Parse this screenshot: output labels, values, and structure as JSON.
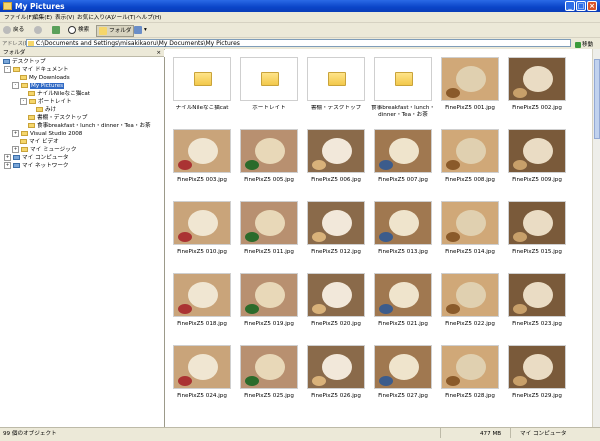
{
  "window": {
    "title": "My Pictures"
  },
  "menu": [
    "ファイル(F)",
    "編集(E)",
    "表示(V)",
    "お気に入り(A)",
    "ツール(T)",
    "ヘルプ(H)"
  ],
  "toolbar": {
    "back": "戻る",
    "search": "検索",
    "folders": "フォルダ"
  },
  "address": {
    "label": "アドレス(D)",
    "path": "C:\\Documents and Settings\\misakikaoru\\My Documents\\My Pictures",
    "go": "移動"
  },
  "pane": {
    "title": "フォルダ",
    "close": "×"
  },
  "tree": [
    {
      "label": "デスクトップ"
    },
    {
      "label": "マイ ドキュメント"
    },
    {
      "label": "My Downloads"
    },
    {
      "label": "My Pictures"
    },
    {
      "label": "ナイルNileなこ猫cat"
    },
    {
      "label": "ポートレイト"
    },
    {
      "label": "みけ"
    },
    {
      "label": "書棚・デスクトップ"
    },
    {
      "label": "食事breakfast・lunch・dinner・Tea・お茶"
    },
    {
      "label": "Visual Studio 2008"
    },
    {
      "label": "マイ ビデオ"
    },
    {
      "label": "マイ ミュージック"
    },
    {
      "label": "マイ コンピュータ"
    },
    {
      "label": "マイ ネットワーク"
    }
  ],
  "items": [
    {
      "label": "ナイルNileなこ猫cat",
      "kind": "folder"
    },
    {
      "label": "ポートレイト",
      "kind": "folder"
    },
    {
      "label": "書棚・デスクトップ",
      "kind": "folder"
    },
    {
      "label": "食事breakfast・lunch・dinner・Tea・お茶",
      "kind": "folder"
    },
    {
      "label": "FinePixZ5 001.jpg",
      "kind": "photo"
    },
    {
      "label": "FinePixZ5 002.jpg",
      "kind": "photo"
    },
    {
      "label": "FinePixZ5 003.jpg",
      "kind": "photo"
    },
    {
      "label": "FinePixZ5 005.jpg",
      "kind": "photo"
    },
    {
      "label": "FinePixZ5 006.jpg",
      "kind": "photo"
    },
    {
      "label": "FinePixZ5 007.jpg",
      "kind": "photo"
    },
    {
      "label": "FinePixZ5 008.jpg",
      "kind": "photo"
    },
    {
      "label": "FinePixZ5 009.jpg",
      "kind": "photo"
    },
    {
      "label": "FinePixZ5 010.jpg",
      "kind": "photo"
    },
    {
      "label": "FinePixZ5 011.jpg",
      "kind": "photo"
    },
    {
      "label": "FinePixZ5 012.jpg",
      "kind": "photo"
    },
    {
      "label": "FinePixZ5 013.jpg",
      "kind": "photo"
    },
    {
      "label": "FinePixZ5 014.jpg",
      "kind": "photo"
    },
    {
      "label": "FinePixZ5 015.jpg",
      "kind": "photo"
    },
    {
      "label": "FinePixZ5 018.jpg",
      "kind": "photo"
    },
    {
      "label": "FinePixZ5 019.jpg",
      "kind": "photo"
    },
    {
      "label": "FinePixZ5 020.jpg",
      "kind": "photo"
    },
    {
      "label": "FinePixZ5 021.jpg",
      "kind": "photo"
    },
    {
      "label": "FinePixZ5 022.jpg",
      "kind": "photo"
    },
    {
      "label": "FinePixZ5 023.jpg",
      "kind": "photo"
    },
    {
      "label": "FinePixZ5 024.jpg",
      "kind": "photo"
    },
    {
      "label": "FinePixZ5 025.jpg",
      "kind": "photo"
    },
    {
      "label": "FinePixZ5 026.jpg",
      "kind": "photo"
    },
    {
      "label": "FinePixZ5 027.jpg",
      "kind": "photo"
    },
    {
      "label": "FinePixZ5 028.jpg",
      "kind": "photo"
    },
    {
      "label": "FinePixZ5 029.jpg",
      "kind": "photo"
    }
  ],
  "status": {
    "count": "99 個のオブジェクト",
    "size": "477 MB",
    "location": "マイ コンピュータ"
  }
}
